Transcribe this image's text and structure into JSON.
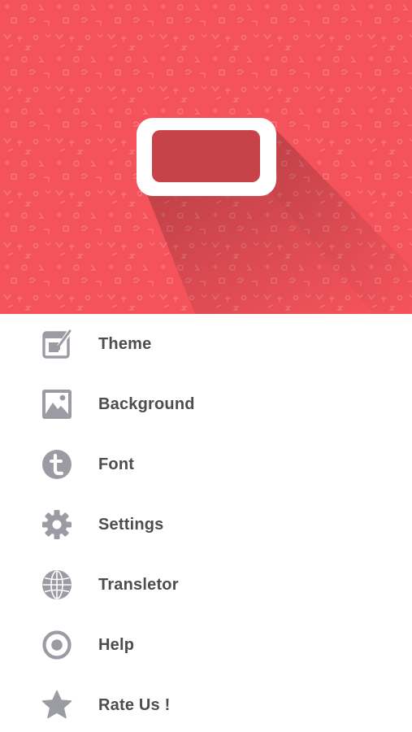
{
  "menu": {
    "items": [
      {
        "label": "Theme",
        "icon": "theme-palette-icon"
      },
      {
        "label": "Background",
        "icon": "image-icon"
      },
      {
        "label": "Font",
        "icon": "font-t-icon"
      },
      {
        "label": "Settings",
        "icon": "gear-icon"
      },
      {
        "label": "Transletor",
        "icon": "globe-icon"
      },
      {
        "label": "Help",
        "icon": "help-ring-icon"
      },
      {
        "label": "Rate Us !",
        "icon": "star-icon"
      }
    ]
  },
  "colors": {
    "banner": "#f5535b",
    "logo": "#ffffff",
    "icon": "#9b9ba3",
    "label": "#4d4d4f"
  }
}
